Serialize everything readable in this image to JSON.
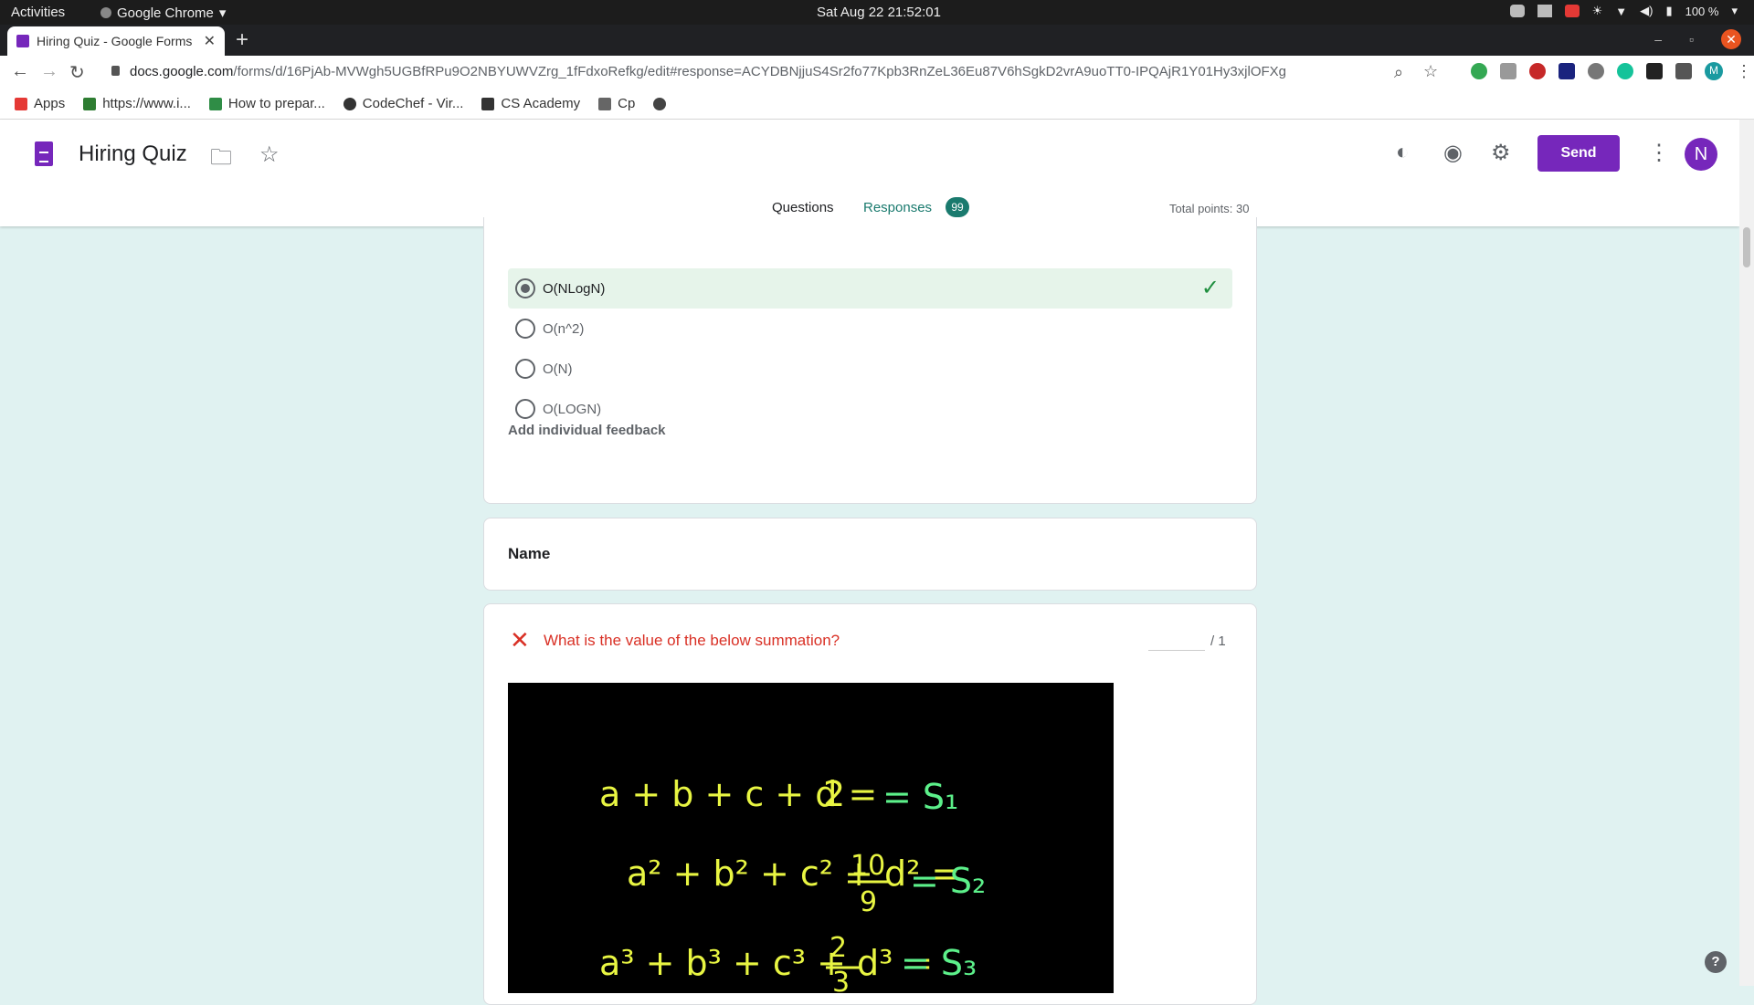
{
  "system_bar": {
    "activities": "Activities",
    "app_name": "Google Chrome",
    "clock": "Sat Aug 22  21:52:01",
    "battery": "100 %"
  },
  "browser": {
    "tab_title": "Hiring Quiz - Google Forms",
    "url_domain": "docs.google.com",
    "url_path": "/forms/d/16PjAb-MVWgh5UGBfRPu9O2NBYUWVZrg_1fFdxoRefkg/edit#response=ACYDBNjjuS4Sr2fo77Kpb3RnZeL36Eu87V6hSgkD2vrA9uoTT0-IPQAjR1Y01Hy3xjlOFXg",
    "profile_initial": "M",
    "bookmarks": [
      {
        "label": "Apps"
      },
      {
        "label": "https://www.i..."
      },
      {
        "label": "How to prepar..."
      },
      {
        "label": "CodeChef - Vir..."
      },
      {
        "label": "CS Academy"
      },
      {
        "label": "Cp"
      }
    ]
  },
  "form": {
    "title": "Hiring Quiz",
    "send_label": "Send",
    "avatar_initial": "N",
    "tab_questions": "Questions",
    "tab_responses": "Responses",
    "responses_count": "99",
    "total_points": "Total points: 30"
  },
  "question1": {
    "options": [
      "O(NLogN)",
      "O(n^2)",
      "O(N)",
      "O(LOGN)"
    ],
    "feedback_label": "Add individual feedback"
  },
  "name_card": {
    "label": "Name"
  },
  "question2": {
    "text": "What is the value of the below summation?",
    "points_of": "/ 1",
    "image_equations": {
      "s1_rhs": "2",
      "s2_rhs_num": "10",
      "s2_rhs_den": "9",
      "s3_rhs_num": "2",
      "s3_rhs_den": "3"
    }
  },
  "colors": {
    "brand_purple": "#7627bb",
    "teal_accent": "#1a7a6e",
    "wrong_red": "#d93025",
    "correct_green": "#1e8e3e",
    "background": "#e0f2f1"
  }
}
